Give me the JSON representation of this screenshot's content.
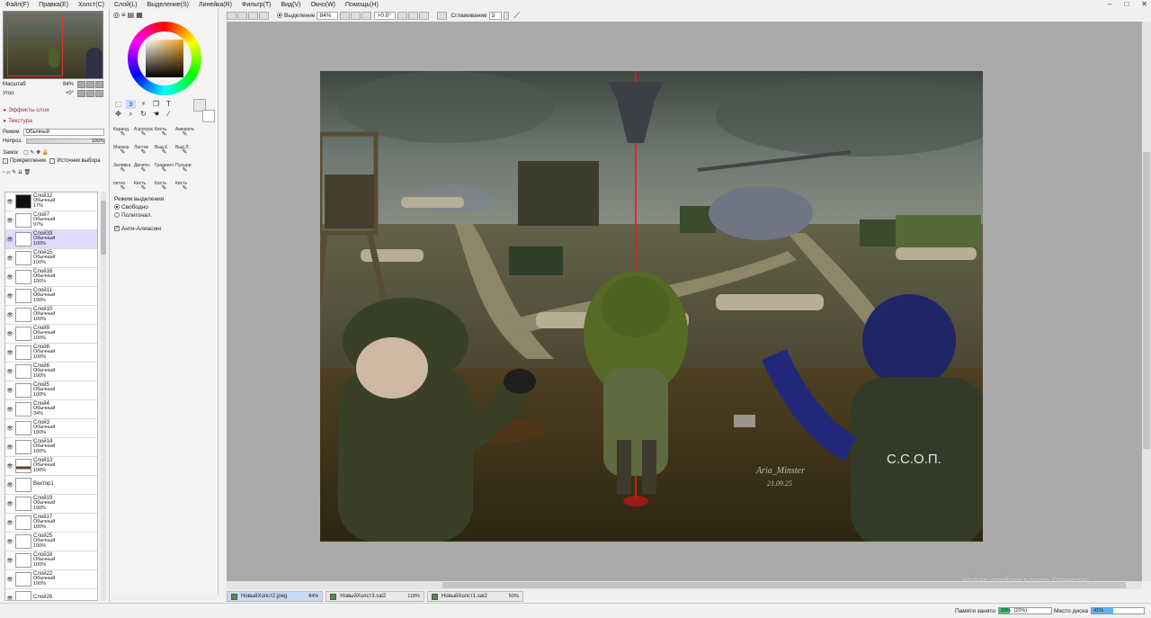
{
  "menu": [
    "Файл(F)",
    "Правка(E)",
    "Холст(C)",
    "Слой(L)",
    "Выделение(S)",
    "Линейка(R)",
    "Фильтр(T)",
    "Вид(V)",
    "Окно(W)",
    "Помощь(H)"
  ],
  "navigator": {
    "scale_label": "Масштаб",
    "scale_value": "84%",
    "angle_label": "Угол",
    "angle_value": "+0°"
  },
  "layer_panel": {
    "effects_label": "Эффекты слоя",
    "texture_label": "Текстура",
    "mode_label": "Режим",
    "mode_value": "Обычный",
    "opacity_label": "Непроз.",
    "opacity_value": "100%",
    "lock_label": "Замок",
    "clip_label": "Прикрепление",
    "source_label": "Источник выбора"
  },
  "layers": [
    {
      "name": "Слой12",
      "mode": "Обычный",
      "opacity": "17%",
      "thumb": "dark"
    },
    {
      "name": "Слой7",
      "mode": "Обычный",
      "opacity": "97%",
      "thumb": "plain"
    },
    {
      "name": "Слой33",
      "mode": "Обычный",
      "opacity": "100%",
      "thumb": "plain",
      "selected": true
    },
    {
      "name": "Слой15",
      "mode": "Обычный",
      "opacity": "100%",
      "thumb": "plain"
    },
    {
      "name": "Слой16",
      "mode": "Обычный",
      "opacity": "100%",
      "thumb": "plain"
    },
    {
      "name": "Слой11",
      "mode": "Обычный",
      "opacity": "100%",
      "thumb": "plain"
    },
    {
      "name": "Слой10",
      "mode": "Обычный",
      "opacity": "100%",
      "thumb": "plain"
    },
    {
      "name": "Слой9",
      "mode": "Обычный",
      "opacity": "100%",
      "thumb": "plain"
    },
    {
      "name": "Слой8",
      "mode": "Обычный",
      "opacity": "100%",
      "thumb": "plain"
    },
    {
      "name": "Слой6",
      "mode": "Обычный",
      "opacity": "100%",
      "thumb": "plain"
    },
    {
      "name": "Слой5",
      "mode": "Обычный",
      "opacity": "100%",
      "thumb": "plain"
    },
    {
      "name": "Слой4",
      "mode": "Обычный",
      "opacity": "34%",
      "thumb": "plain"
    },
    {
      "name": "Слой3",
      "mode": "Обычный",
      "opacity": "100%",
      "thumb": "plain"
    },
    {
      "name": "Слой14",
      "mode": "Обычный",
      "opacity": "100%",
      "thumb": "plain"
    },
    {
      "name": "Слой13",
      "mode": "Обычный",
      "opacity": "100%",
      "thumb": "strip"
    },
    {
      "name": "Вектор1",
      "mode": "",
      "opacity": "",
      "thumb": "plain"
    },
    {
      "name": "Слой19",
      "mode": "Обычный",
      "opacity": "100%",
      "thumb": "plain"
    },
    {
      "name": "Слой17",
      "mode": "Обычный",
      "opacity": "100%",
      "thumb": "plain"
    },
    {
      "name": "Слой25",
      "mode": "Обычный",
      "opacity": "100%",
      "thumb": "plain"
    },
    {
      "name": "Слой18",
      "mode": "Обычный",
      "opacity": "100%",
      "thumb": "plain"
    },
    {
      "name": "Слой22",
      "mode": "Обычный",
      "opacity": "100%",
      "thumb": "plain"
    },
    {
      "name": "Слой26",
      "mode": "",
      "opacity": "",
      "thumb": "plain"
    }
  ],
  "brushes": [
    "Каранд.",
    "Аэрограф",
    "Кисть",
    "Акварель",
    "",
    "Маркер",
    "Ластик",
    "Выд.К.",
    "Выд.Л.",
    "",
    "Заливка",
    "Двоичн.",
    "Градиент",
    "Пузыри",
    "",
    "пятно",
    "Кисть",
    "Кисть",
    "Кисть",
    ""
  ],
  "selection_options": {
    "mode_label": "Режим выделения",
    "free_label": "Свободно",
    "polygon_label": "Полигонал.",
    "antialias_label": "Анти-Алиасинг"
  },
  "toolbar": {
    "selection_label": "Выделение",
    "zoom_value": "84%",
    "angle_value": "+0.0°",
    "smoothing_label": "Сглаживание",
    "smoothing_value": "3"
  },
  "artwork": {
    "signature": "Aria_Minster",
    "date": "21.09.25",
    "patch_text": "С.С.О.П."
  },
  "tabs": [
    {
      "name": "НовыйХолст2.jpeg",
      "zoom": "84%",
      "active": true
    },
    {
      "name": "НовыйХолст3.sai2",
      "zoom": "118%",
      "active": false
    },
    {
      "name": "НовыйХолст1.sai2",
      "zoom": "50%",
      "active": false
    }
  ],
  "status": {
    "memory_label": "Памяти занято",
    "memory_value": "20%",
    "memory_extra": "(20%)",
    "memory_fraction": 0.2,
    "disk_label": "Место диска",
    "disk_value": "41%",
    "disk_fraction": 0.41,
    "memory_color": "#2ecc71",
    "disk_color": "#5ab4f0"
  },
  "watermark": "Windows, перейдите в раздел \"Параметры\""
}
